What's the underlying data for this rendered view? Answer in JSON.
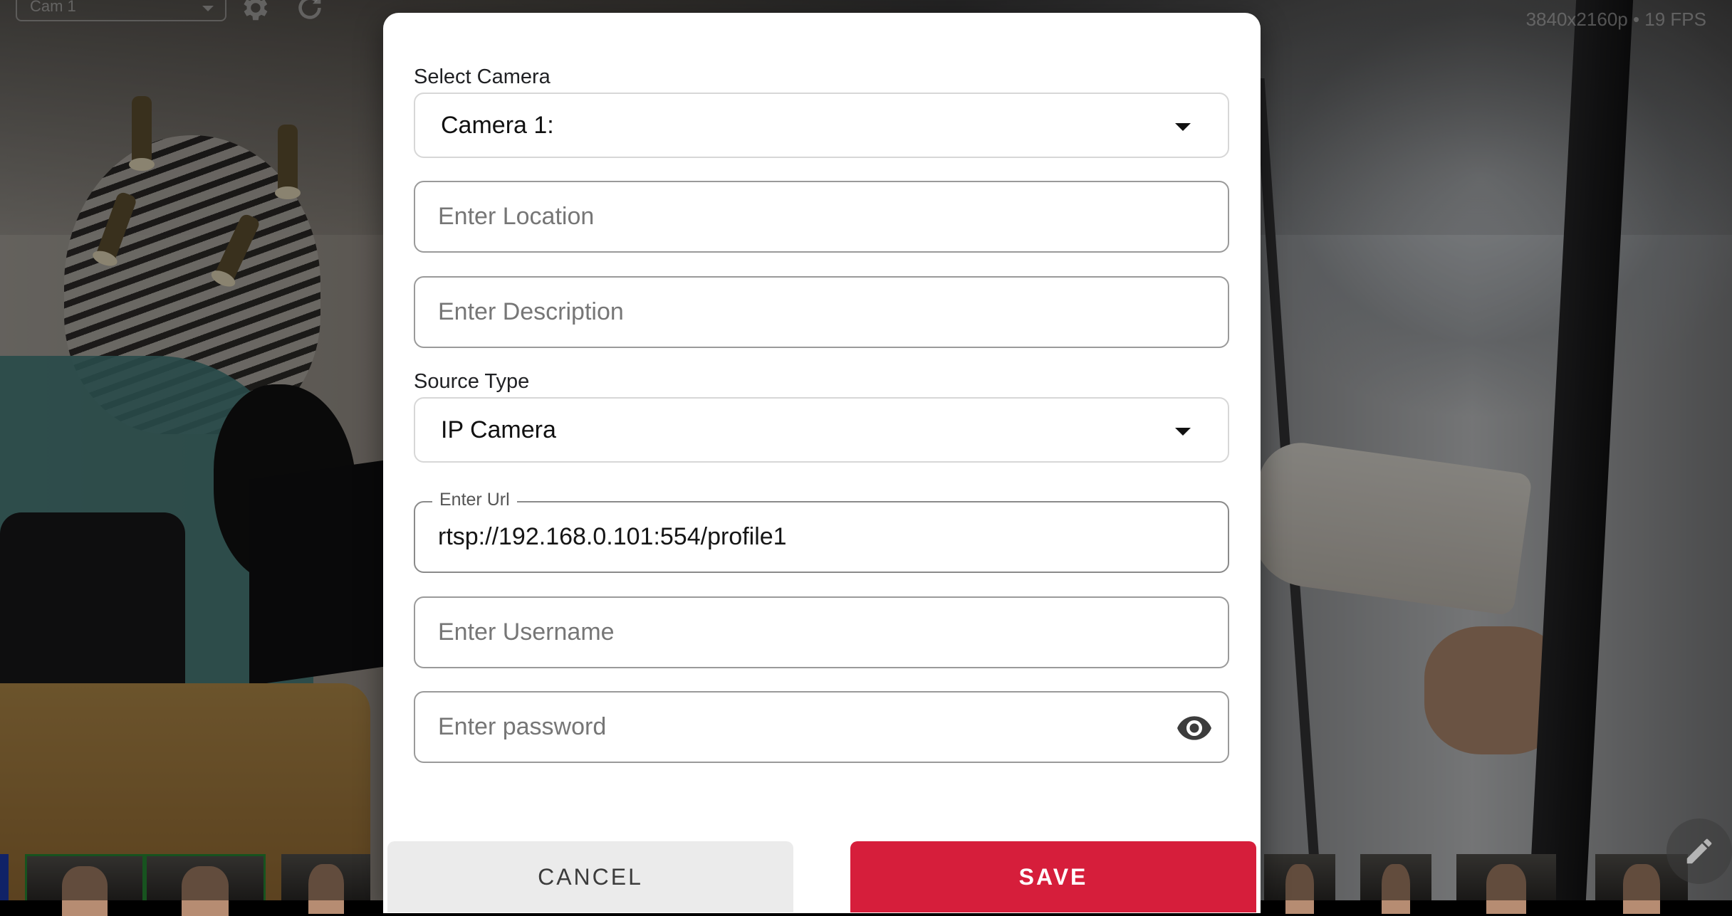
{
  "background": {
    "camera_select_value": "Cam 1",
    "resolution_fps": "3840x2160p • 19 FPS"
  },
  "dialog": {
    "select_camera": {
      "label": "Select Camera",
      "value": "Camera 1:"
    },
    "location": {
      "placeholder": "Enter Location",
      "value": ""
    },
    "description": {
      "placeholder": "Enter Description",
      "value": ""
    },
    "source_type": {
      "label": "Source Type",
      "value": "IP Camera"
    },
    "url": {
      "label": "Enter Url",
      "value": "rtsp://192.168.0.101:554/profile1"
    },
    "username": {
      "placeholder": "Enter Username",
      "value": ""
    },
    "password": {
      "placeholder": "Enter password",
      "value": ""
    },
    "buttons": {
      "cancel": "CANCEL",
      "save": "SAVE"
    }
  },
  "colors": {
    "save_button": "#d61e3b",
    "cancel_button": "#ebebeb",
    "selected_thumbnail_border": "#2b9a3a"
  },
  "icons": {
    "camera_settings": "gear-icon",
    "refresh": "refresh-icon",
    "password_visibility": "eye-icon",
    "edit": "pencil-icon"
  }
}
